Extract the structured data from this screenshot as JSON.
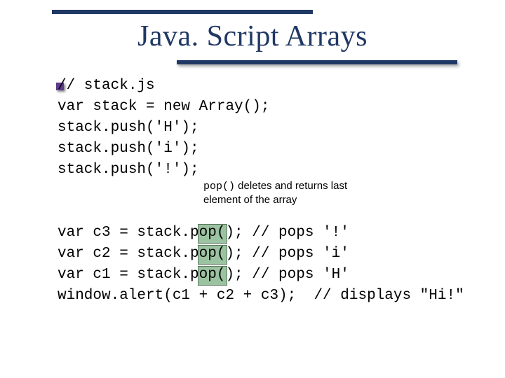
{
  "title": "Java. Script Arrays",
  "code_upper": [
    "// stack.js",
    "var stack = new Array();",
    "stack.push('H');",
    "stack.push('i');",
    "stack.push('!');"
  ],
  "annotation": {
    "code_token": "pop()",
    "rest_line1": " deletes and returns last",
    "line2": "element of the array"
  },
  "code_lower": [
    "var c3 = stack.pop(); // pops '!'",
    "var c2 = stack.pop(); // pops 'i'",
    "var c1 = stack.pop(); // pops 'H'",
    "window.alert(c1 + c2 + c3);  // displays \"Hi!\""
  ],
  "highlight_token": "pop"
}
